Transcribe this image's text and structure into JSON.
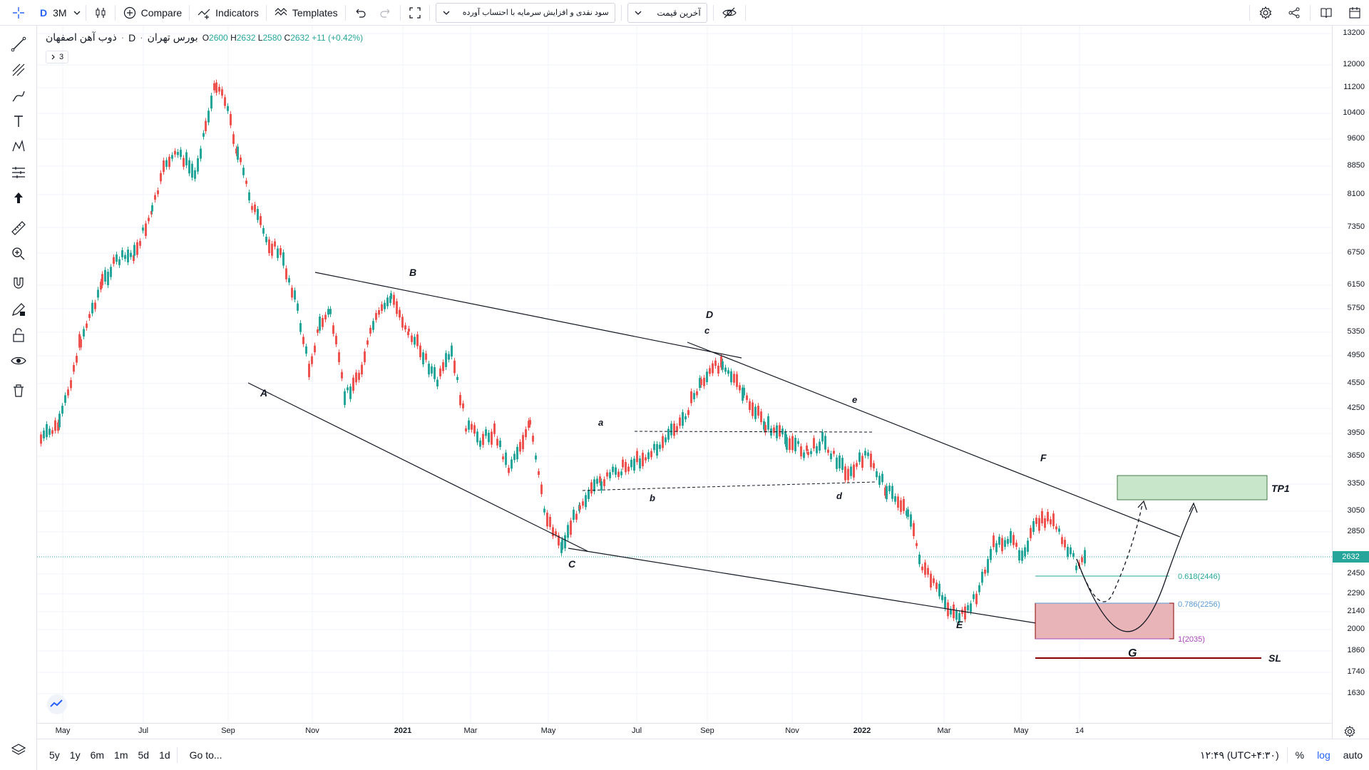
{
  "toolbar": {
    "symbol_short": "D",
    "interval": "3M",
    "compare_label": "Compare",
    "indicators_label": "Indicators",
    "templates_label": "Templates",
    "indicator_select": "سود نقدی و افزایش سرمایه با احتساب آورده",
    "price_select": "آخرین قیمت"
  },
  "legend": {
    "symbol": "ذوب آهن اصفهان",
    "sep1": "·",
    "interval": "D",
    "sep2": "·",
    "exchange": "بورس تهران",
    "o_key": "O",
    "o": "2600",
    "h_key": "H",
    "h": "2632",
    "l_key": "L",
    "l": "2580",
    "c_key": "C",
    "c": "2632",
    "change": "+11 (+0.42%)",
    "collapse_count": "3"
  },
  "price_axis": {
    "ticks": [
      "13200",
      "12000",
      "11200",
      "10400",
      "9600",
      "8850",
      "8100",
      "7350",
      "6750",
      "6150",
      "5750",
      "5350",
      "4950",
      "4550",
      "4250",
      "3950",
      "3650",
      "3350",
      "3050",
      "2850",
      "2450",
      "2290",
      "2140",
      "2000",
      "1860",
      "1740",
      "1630"
    ],
    "current": "2632"
  },
  "time_axis": {
    "ticks": [
      {
        "label": "May",
        "bold": false
      },
      {
        "label": "Jul",
        "bold": false
      },
      {
        "label": "Sep",
        "bold": false
      },
      {
        "label": "Nov",
        "bold": false
      },
      {
        "label": "2021",
        "bold": true
      },
      {
        "label": "Mar",
        "bold": false
      },
      {
        "label": "May",
        "bold": false
      },
      {
        "label": "Jul",
        "bold": false
      },
      {
        "label": "Sep",
        "bold": false
      },
      {
        "label": "Nov",
        "bold": false
      },
      {
        "label": "2022",
        "bold": true
      },
      {
        "label": "Mar",
        "bold": false
      },
      {
        "label": "May",
        "bold": false
      },
      {
        "label": "14",
        "bold": false
      }
    ]
  },
  "annotations": {
    "A": "A",
    "B": "B",
    "C": "C",
    "D": "D",
    "E": "E",
    "F": "F",
    "G": "G",
    "a": "a",
    "b": "b",
    "c": "c",
    "d": "d",
    "e": "e",
    "tp1": "TP1",
    "sl": "SL",
    "fib618": "0.618(2446)",
    "fib786": "0.786(2256)",
    "fib1": "1(2035)"
  },
  "bottom": {
    "ranges": [
      "5y",
      "1y",
      "6m",
      "1m",
      "5d",
      "1d"
    ],
    "goto": "Go to...",
    "time": "۱۲:۴۹ (UTC+۴:۳۰)",
    "percent": "%",
    "log": "log",
    "auto": "auto"
  },
  "colors": {
    "up": "#26a69a",
    "down": "#ef5350",
    "accent": "#2962ff",
    "tp_fill": "#c8e6c9",
    "sl_fill": "#e8b4b8",
    "sl_line": "#8b0000"
  }
}
